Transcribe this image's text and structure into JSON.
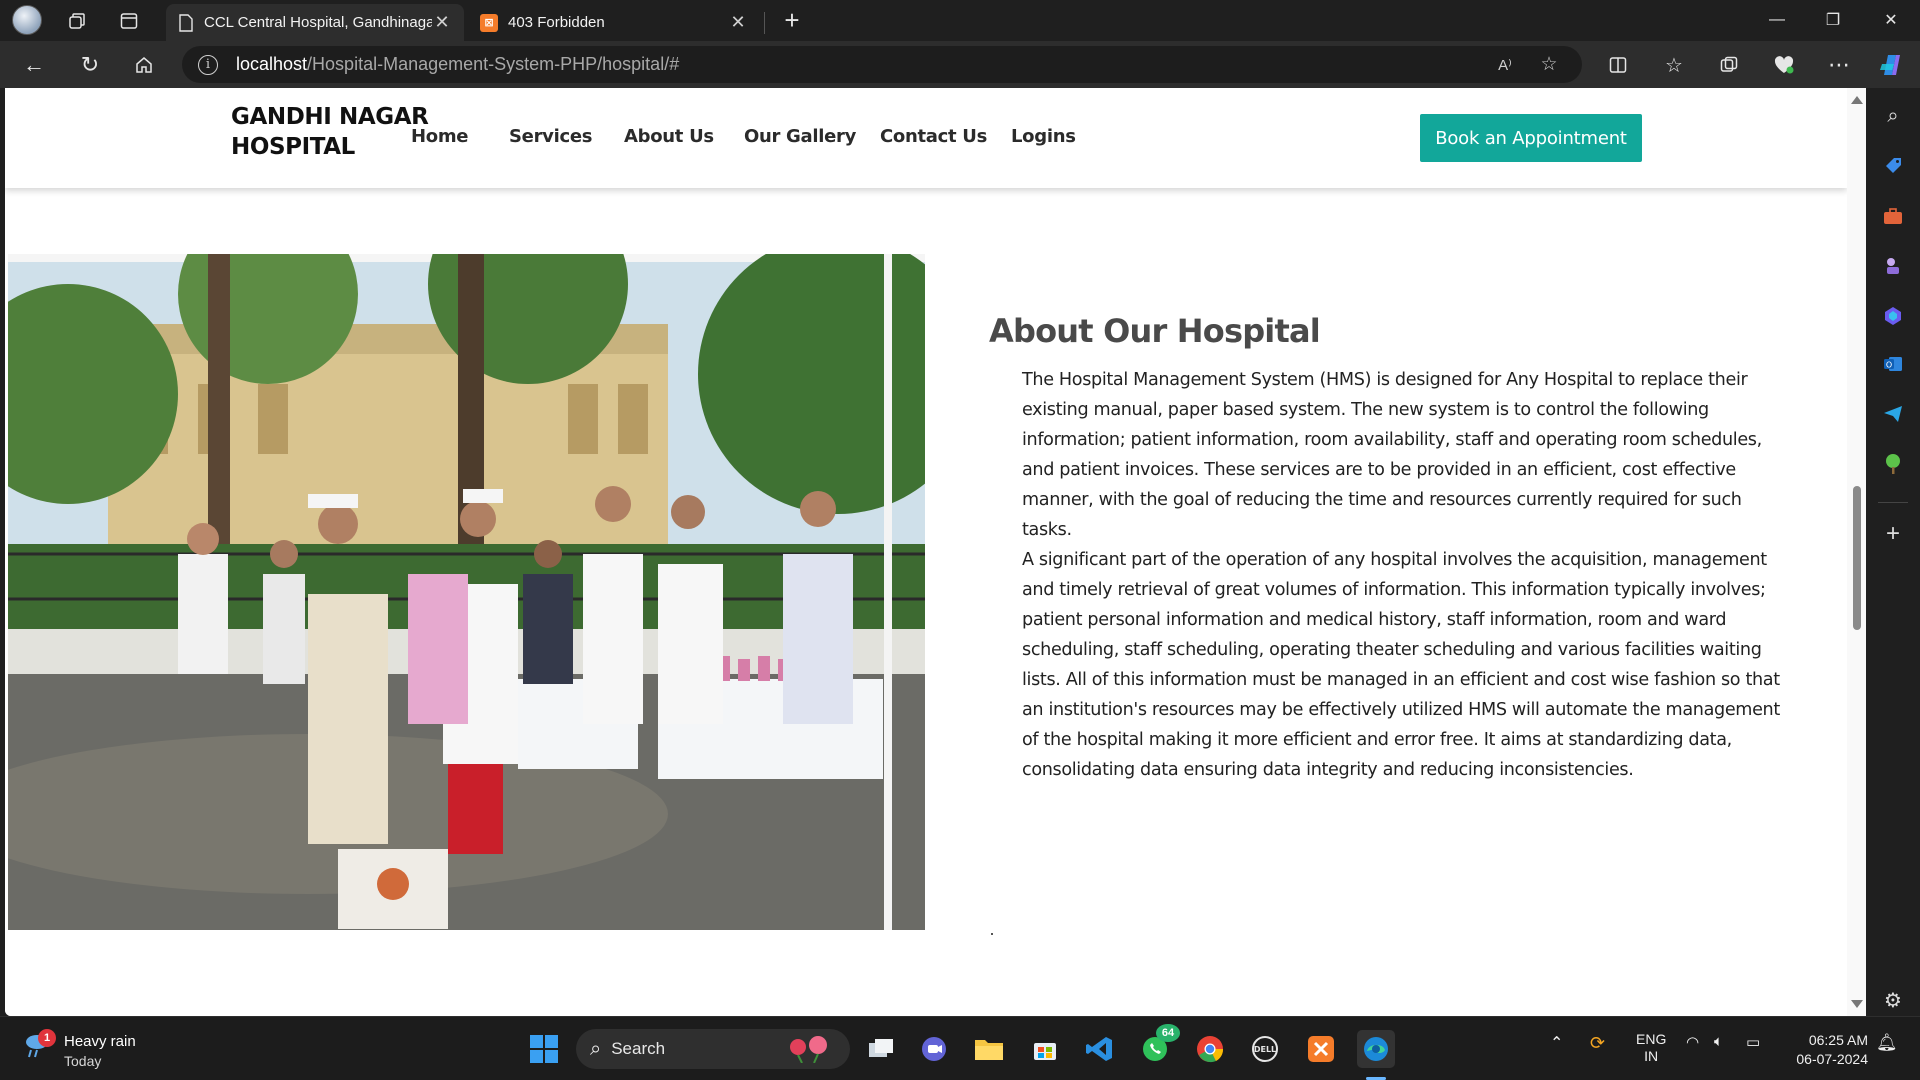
{
  "browser": {
    "tabs": [
      {
        "title": "CCL Central Hospital, Gandhinagar",
        "active": true
      },
      {
        "title": "403 Forbidden",
        "active": false
      }
    ],
    "url_host": "localhost",
    "url_path": "/Hospital-Management-System-PHP/hospital/#"
  },
  "site": {
    "brand_line1": "GANDHI NAGAR",
    "brand_line2": "HOSPITAL",
    "nav": [
      "Home",
      "Services",
      "About Us",
      "Our Gallery",
      "Contact Us",
      "Logins"
    ],
    "cta": "Book an Appointment",
    "accent": "#12a79a"
  },
  "about": {
    "title": "About Our Hospital",
    "paragraph1": "The Hospital Management System (HMS) is designed for Any Hospital to replace their existing manual, paper based system. The new system is to control the following information; patient information, room availability, staff and operating room schedules, and patient invoices. These services are to be provided in an efficient, cost effective manner, with the goal of reducing the time and resources currently required for such tasks.",
    "paragraph2": "A significant part of the operation of any hospital involves the acquisition, management and timely retrieval of great volumes of information. This information typically involves; patient personal information and medical history, staff information, room and ward scheduling, staff scheduling, operating theater scheduling and various facilities waiting lists. All of this information must be managed in an efficient and cost wise fashion so that an institution's resources may be effectively utilized HMS will automate the management of the hospital making it more efficient and error free. It aims at standardizing data, consolidating data ensuring data integrity and reducing inconsistencies.",
    "trailing": "."
  },
  "taskbar": {
    "weather_title": "Heavy rain",
    "weather_sub": "Today",
    "weather_badge": "1",
    "search_placeholder": "Search",
    "whatsapp_badge": "64",
    "lang_line1": "ENG",
    "lang_line2": "IN",
    "time": "06:25 AM",
    "date": "06-07-2024"
  }
}
